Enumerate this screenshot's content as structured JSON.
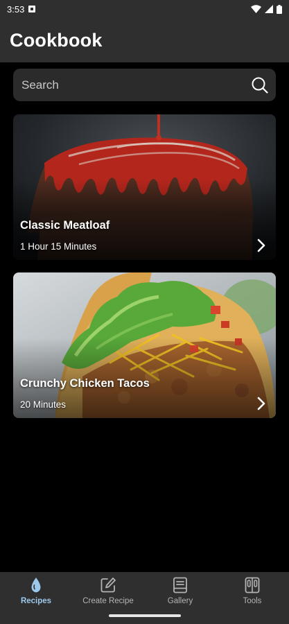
{
  "status_bar": {
    "time": "3:53"
  },
  "header": {
    "title": "Cookbook"
  },
  "search": {
    "placeholder": "Search"
  },
  "recipes": [
    {
      "title": "Classic Meatloaf",
      "duration": "1 Hour 15 Minutes"
    },
    {
      "title": "Crunchy Chicken Tacos",
      "duration": "20 Minutes"
    }
  ],
  "bottom_nav": {
    "items": [
      {
        "label": "Recipes",
        "icon": "drop-icon",
        "active": true
      },
      {
        "label": "Create Recipe",
        "icon": "edit-icon",
        "active": false
      },
      {
        "label": "Gallery",
        "icon": "book-icon",
        "active": false
      },
      {
        "label": "Tools",
        "icon": "tools-icon",
        "active": false
      }
    ]
  },
  "colors": {
    "background": "#000000",
    "surface": "#2f2f2f",
    "search_bg": "#2b2b2b",
    "accent": "#9cc8ec",
    "inactive": "#b4b4b4"
  }
}
